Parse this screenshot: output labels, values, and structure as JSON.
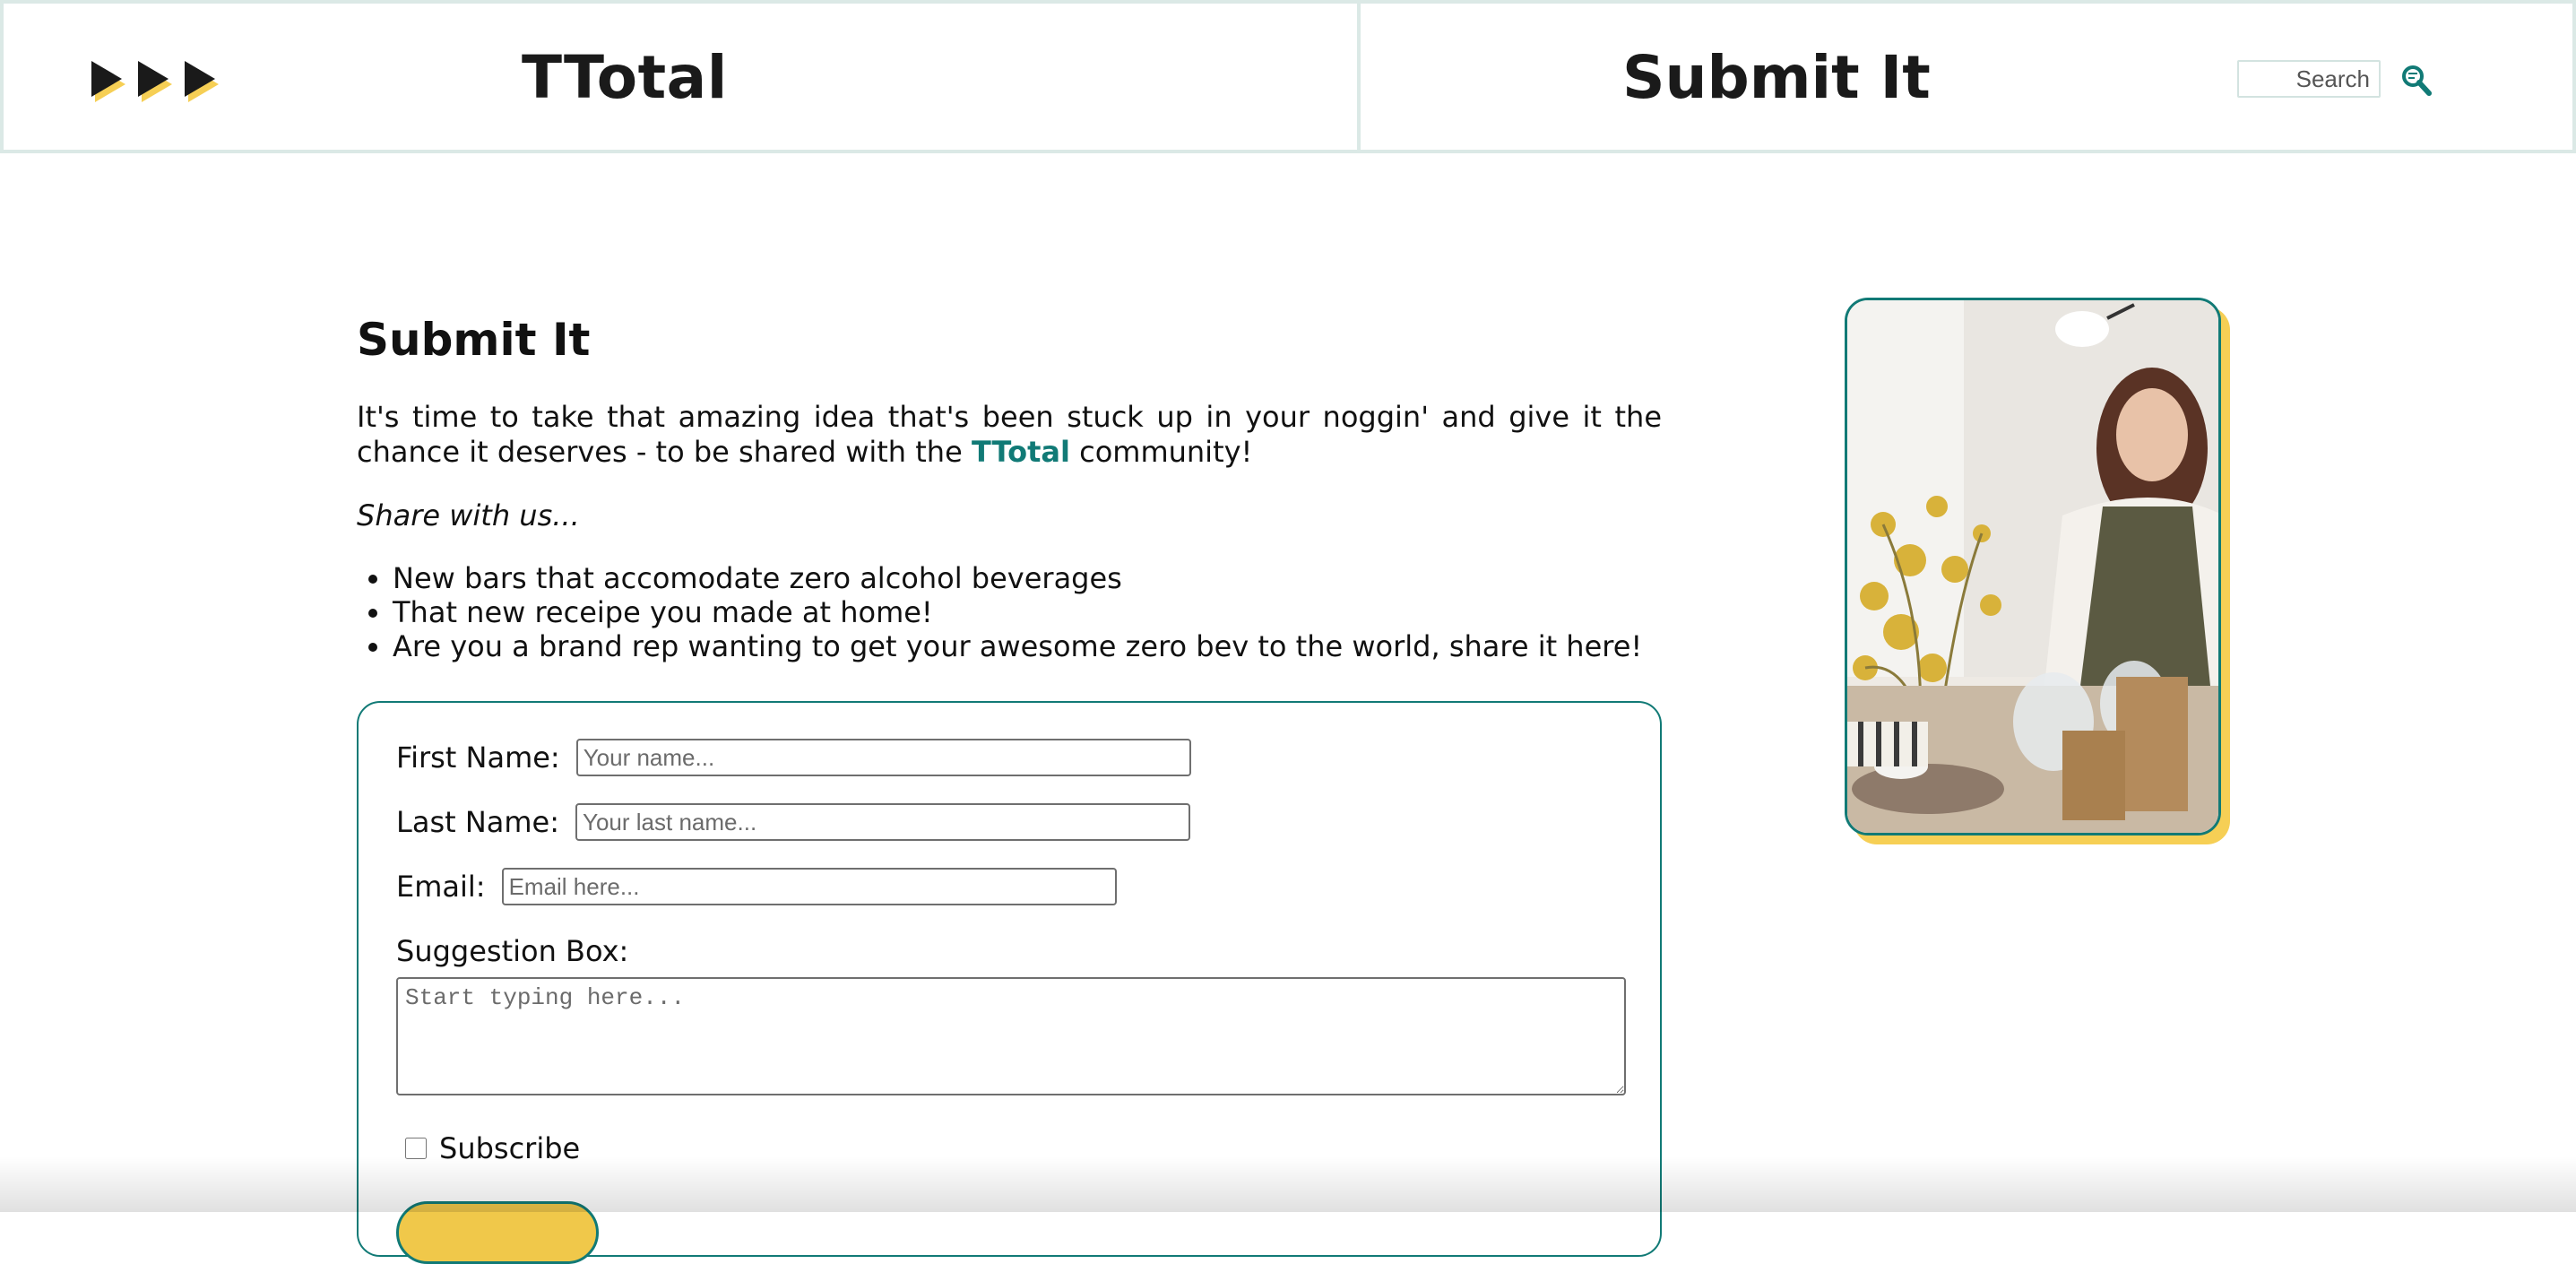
{
  "header": {
    "brand": "TTotal",
    "page_title": "Submit It",
    "search_placeholder": "Search"
  },
  "main": {
    "title": "Submit It",
    "intro_before": "It's time to take that amazing idea that's been stuck up in your noggin' and give it the chance it deserves - to be shared with the ",
    "intro_brand": "TTotal",
    "intro_after": " community!",
    "share_text": "Share with us...",
    "list": [
      "New bars that accomodate zero alcohol beverages",
      "That new receipe you made at home!",
      "Are you a brand rep wanting to get your awesome zero bev to the world, share it here!"
    ]
  },
  "form": {
    "first_name_label": "First Name:",
    "first_name_placeholder": "Your name...",
    "last_name_label": "Last Name:",
    "last_name_placeholder": "Your last name...",
    "email_label": "Email:",
    "email_placeholder": "Email here...",
    "suggestion_label": "Suggestion Box:",
    "suggestion_placeholder": "Start typing here...",
    "subscribe_label": "Subscribe",
    "subscribe_checked": false
  },
  "colors": {
    "accent_teal": "#117a76",
    "accent_yellow": "#f6cf55",
    "header_border": "#dbe9e6"
  },
  "icons": {
    "logo": "triple-play-arrows-logo",
    "search": "magnifier-icon"
  }
}
